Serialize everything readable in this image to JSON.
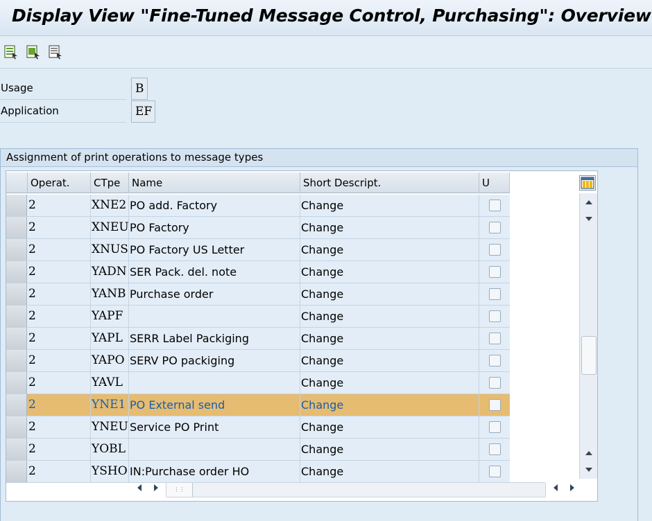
{
  "window": {
    "title": "Display View \"Fine-Tuned Message Control, Purchasing\": Overview"
  },
  "toolbar": {
    "buttons": [
      {
        "icon": "details-icon"
      },
      {
        "icon": "copy-select-icon"
      },
      {
        "icon": "print-list-icon"
      }
    ]
  },
  "fields": {
    "usage": {
      "label": "Usage",
      "value": "B"
    },
    "application": {
      "label": "Application",
      "value": "EF"
    }
  },
  "group": {
    "title": "Assignment of print operations to message types"
  },
  "table": {
    "columns": [
      "Operat.",
      "CTpe",
      "Name",
      "Short Descript.",
      "U"
    ],
    "rows": [
      {
        "op": "2",
        "ctype": "XNE2",
        "name": "PO add. Factory",
        "desc": "Change",
        "selected": false
      },
      {
        "op": "2",
        "ctype": "XNEU",
        "name": "PO Factory",
        "desc": "Change",
        "selected": false
      },
      {
        "op": "2",
        "ctype": "XNUS",
        "name": "PO Factory US Letter",
        "desc": "Change",
        "selected": false
      },
      {
        "op": "2",
        "ctype": "YADN",
        "name": "SER Pack. del. note",
        "desc": "Change",
        "selected": false
      },
      {
        "op": "2",
        "ctype": "YANB",
        "name": "Purchase order",
        "desc": "Change",
        "selected": false
      },
      {
        "op": "2",
        "ctype": "YAPF",
        "name": "",
        "desc": "Change",
        "selected": false
      },
      {
        "op": "2",
        "ctype": "YAPL",
        "name": "SERR Label Packiging",
        "desc": "Change",
        "selected": false
      },
      {
        "op": "2",
        "ctype": "YAPO",
        "name": "SERV PO packiging",
        "desc": "Change",
        "selected": false
      },
      {
        "op": "2",
        "ctype": "YAVL",
        "name": "",
        "desc": "Change",
        "selected": false
      },
      {
        "op": "2",
        "ctype": "YNE1",
        "name": "PO External send",
        "desc": "Change",
        "selected": true
      },
      {
        "op": "2",
        "ctype": "YNEU",
        "name": "Service PO Print",
        "desc": "Change",
        "selected": false
      },
      {
        "op": "2",
        "ctype": "YOBL",
        "name": "",
        "desc": "Change",
        "selected": false
      },
      {
        "op": "2",
        "ctype": "YSHO",
        "name": "IN:Purchase order HO",
        "desc": "Change",
        "selected": false
      }
    ]
  },
  "colors": {
    "selected_row": "#e5bc72",
    "selected_text": "#1a5fa8",
    "row_bg": "#e3edf7"
  }
}
